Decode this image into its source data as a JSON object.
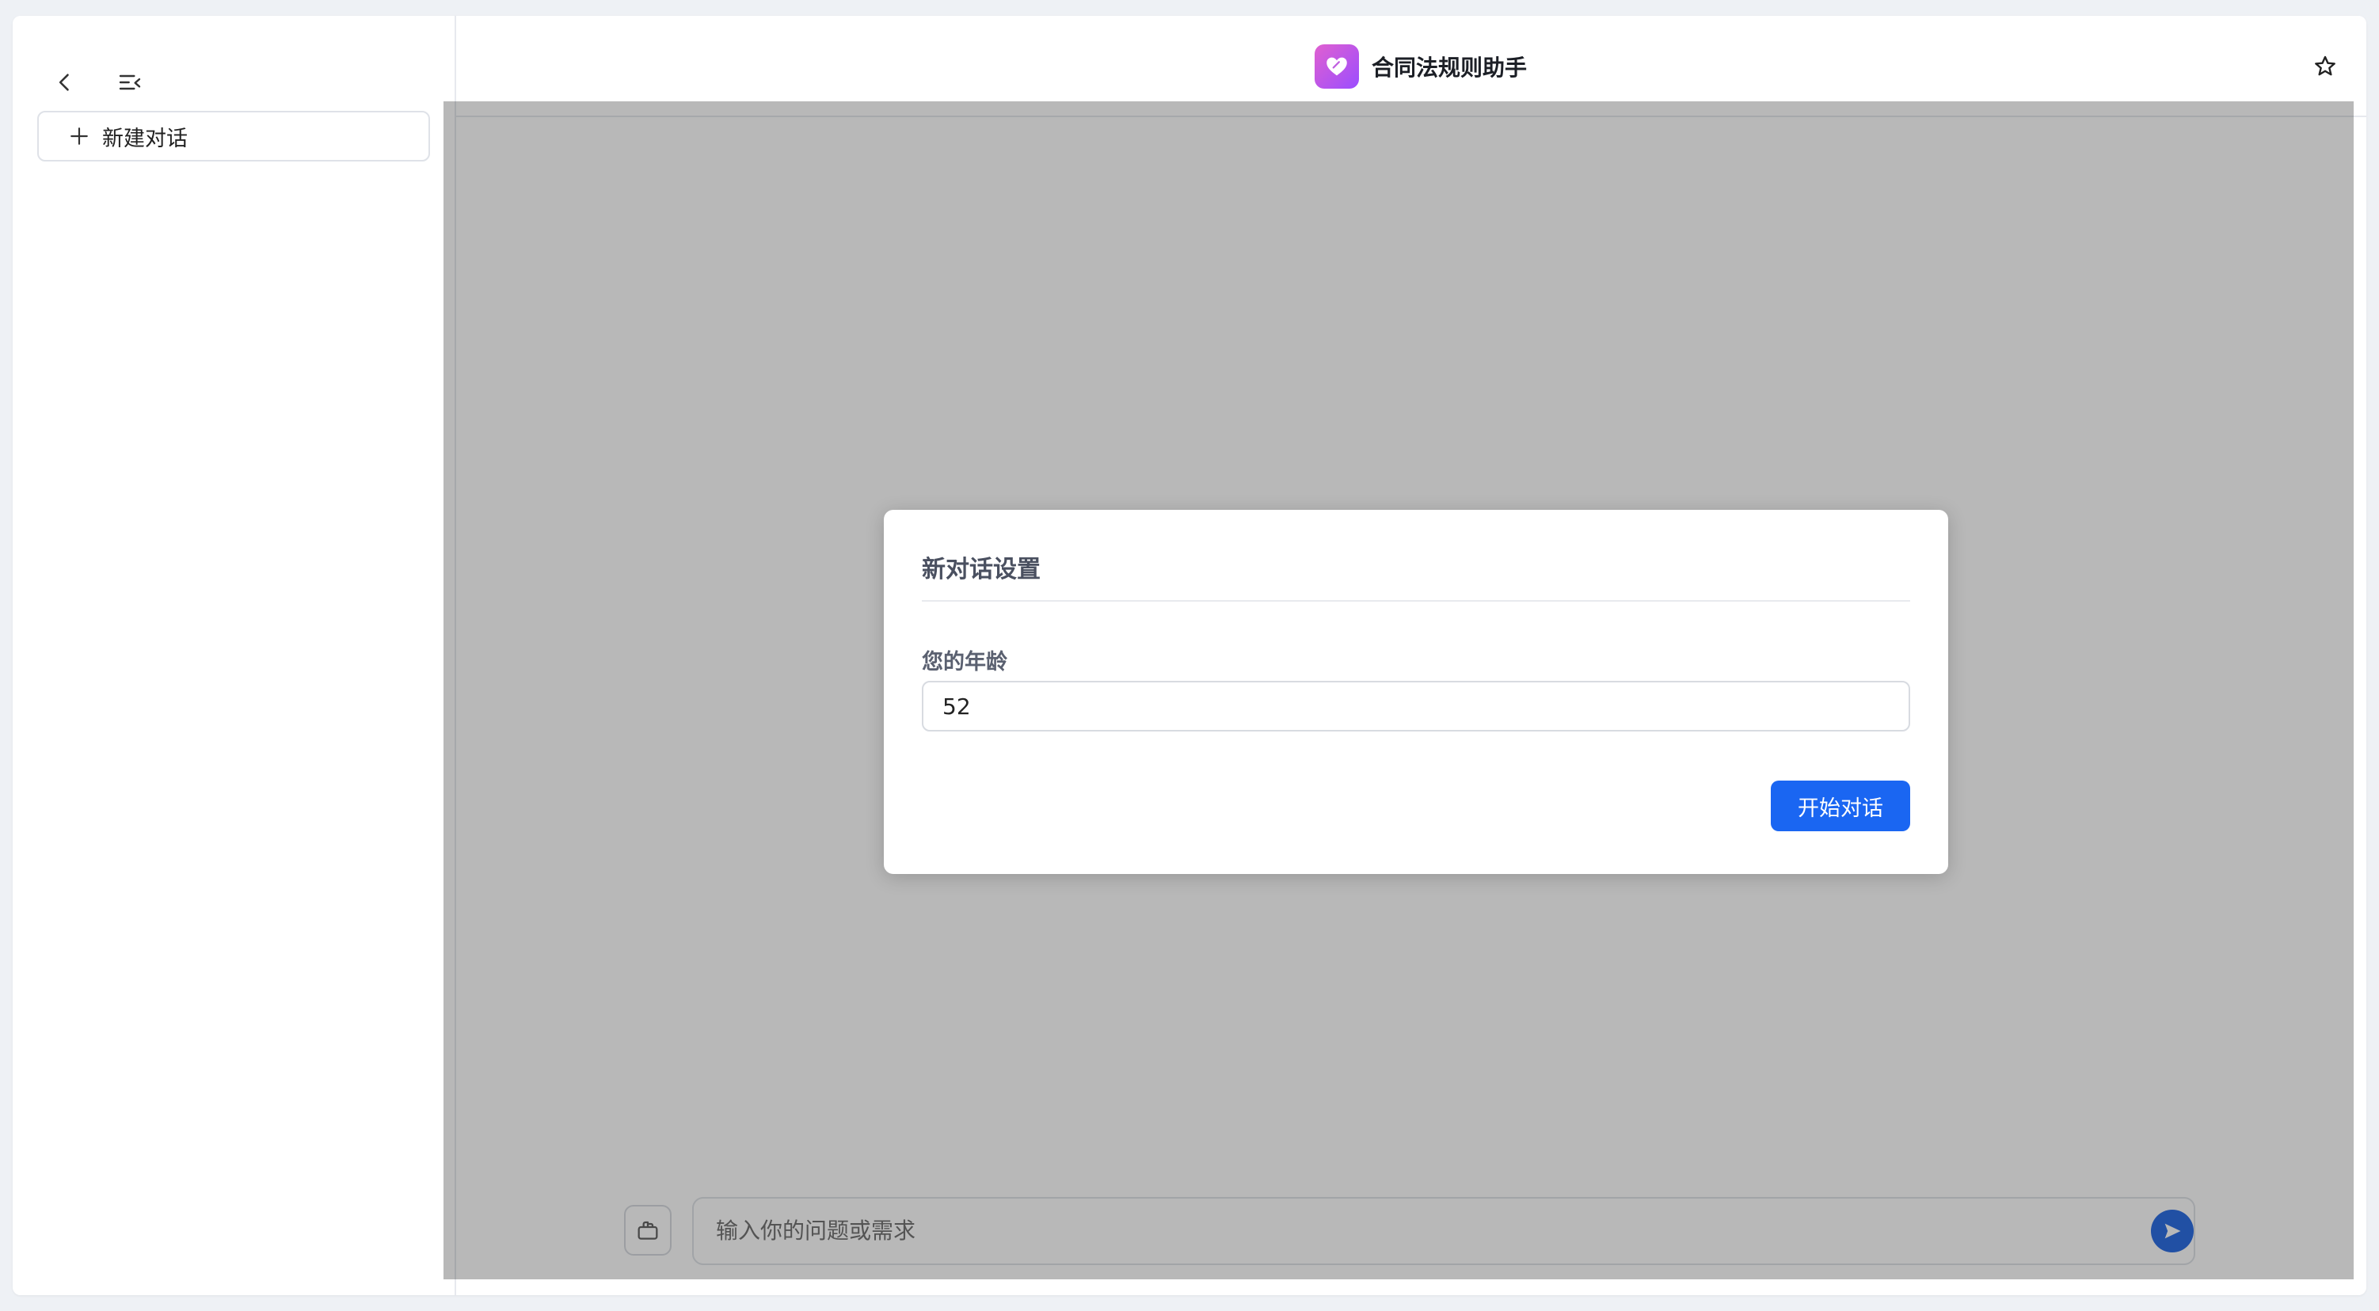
{
  "sidebar": {
    "back_icon": "chevron-left-icon",
    "collapse_icon": "menu-collapse-icon",
    "new_chat_label": "新建对话"
  },
  "header": {
    "title": "合同法规则助手",
    "favorite_icon": "star-icon"
  },
  "composer": {
    "placeholder": "输入你的问题或需求"
  },
  "modal": {
    "title": "新对话设置",
    "age_label": "您的年龄",
    "age_value": "52",
    "start_label": "开始对话"
  },
  "colors": {
    "accent": "#1a66f2",
    "logo_gradient_start": "#e060d0",
    "logo_gradient_end": "#9b4dff",
    "overlay": "rgba(0,0,0,0.28)"
  }
}
